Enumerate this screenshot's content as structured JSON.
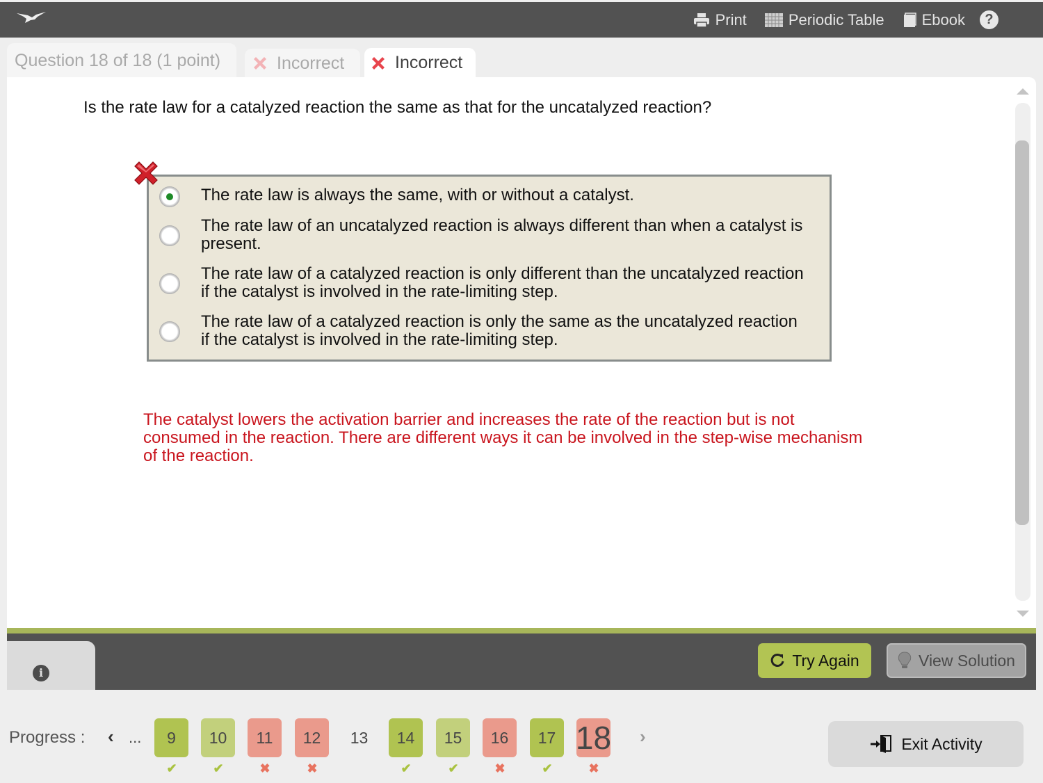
{
  "topbar": {
    "logo": "bird-logo",
    "actions": [
      {
        "label": "Print",
        "icon": "printer-icon"
      },
      {
        "label": "Periodic Table",
        "icon": "table-grid-icon"
      },
      {
        "label": "Ebook",
        "icon": "book-icon"
      }
    ],
    "help_glyph": "?"
  },
  "tabs": [
    {
      "label": "Question 18 of 18 (1 point)",
      "state": "inactive"
    },
    {
      "label": "Incorrect",
      "state": "inactive",
      "icon": "x-mark-icon"
    },
    {
      "label": "Incorrect",
      "state": "active",
      "icon": "x-mark-icon"
    }
  ],
  "question": {
    "text": "Is the rate law for a catalyzed reaction the same as that for the uncatalyzed reaction?",
    "result": "incorrect",
    "choices": [
      {
        "text": "The rate law is always the same, with or without a catalyst.",
        "selected": true
      },
      {
        "text": "The rate law of an uncatalyzed reaction is always different than when a catalyst is present.",
        "selected": false
      },
      {
        "text": "The rate law of a catalyzed reaction is only different than the uncatalyzed reaction if the catalyst is involved in the rate-limiting step.",
        "selected": false
      },
      {
        "text": "The rate law of a catalyzed reaction is only the same as the uncatalyzed reaction if the catalyst is involved in the rate-limiting step.",
        "selected": false
      }
    ],
    "feedback": "The catalyst lowers the activation barrier and increases the rate of the reaction but is not consumed in the reaction.  There are different ways it can be involved in the step-wise mechanism of the reaction."
  },
  "actions": {
    "info_glyph": "i",
    "try_again": "Try Again",
    "view_solution": "View Solution"
  },
  "progress": {
    "label": "Progress :",
    "prev": "‹",
    "ellipsis": "...",
    "next": "›",
    "items": [
      {
        "num": "9",
        "status": "correct",
        "mark": "✔"
      },
      {
        "num": "10",
        "status": "correct-light",
        "mark": "✔"
      },
      {
        "num": "11",
        "status": "incorrect",
        "mark": "✖"
      },
      {
        "num": "12",
        "status": "incorrect",
        "mark": "✖"
      },
      {
        "num": "13",
        "status": "unanswered",
        "mark": ""
      },
      {
        "num": "14",
        "status": "correct",
        "mark": "✔"
      },
      {
        "num": "15",
        "status": "correct-light",
        "mark": "✔"
      },
      {
        "num": "16",
        "status": "incorrect",
        "mark": "✖"
      },
      {
        "num": "17",
        "status": "correct",
        "mark": "✔"
      },
      {
        "num": "18",
        "status": "incorrect",
        "mark": "✖",
        "current": true
      }
    ]
  },
  "exit": {
    "label": "Exit Activity"
  },
  "colors": {
    "topbar": "#525252",
    "correct": "#b0c351",
    "correct_light": "#c2d07c",
    "incorrect": "#ea9a8c",
    "feedback_red": "#c9151e",
    "accent_green_line": "#a7b65a",
    "choice_bg": "#ebe7d9"
  }
}
